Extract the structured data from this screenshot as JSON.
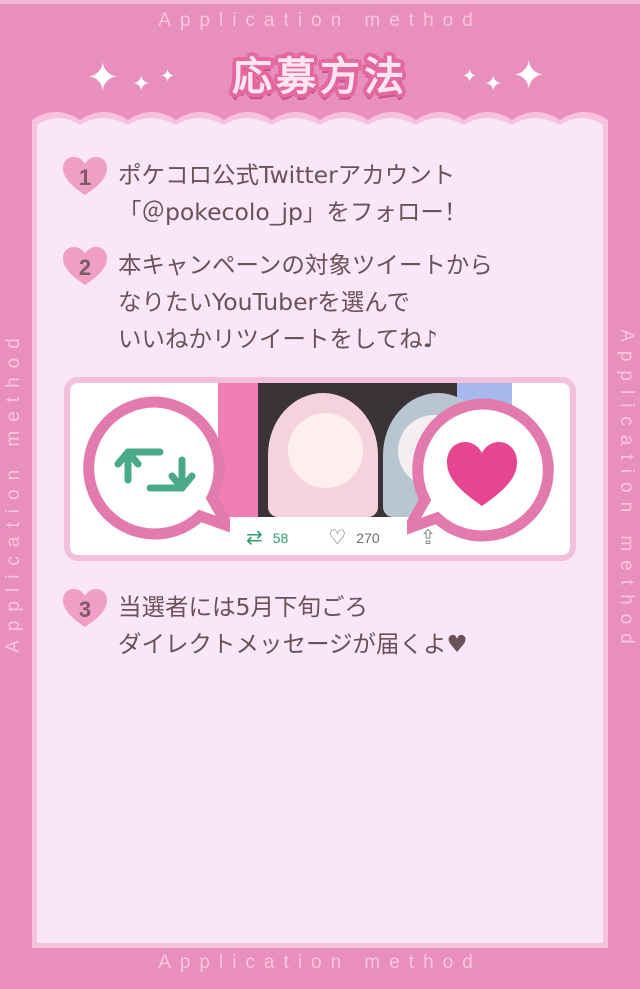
{
  "border_text": {
    "top": "Application method",
    "bottom": "Application method",
    "left": "Application method",
    "right": "Application method"
  },
  "title": "応募方法",
  "steps": [
    {
      "number": "1",
      "lines": [
        "ポケコロ公式Twitterアカウント",
        "「＠pokecolo_jp」をフォロー！"
      ]
    },
    {
      "number": "2",
      "lines": [
        "本キャンペーンの対象ツイートから",
        "なりたいYouTuberを選んで",
        "いいねかリツイートをしてね♪"
      ]
    },
    {
      "number": "3",
      "lines": [
        "当選者には5月下旬ごろ",
        "ダイレクトメッセージが届くよ♥"
      ]
    }
  ],
  "tweet": {
    "retweet_count": "58",
    "like_count": "270",
    "icons": {
      "retweet": "retweet-icon",
      "like": "heart-outline-icon",
      "share": "share-icon"
    }
  },
  "colors": {
    "border_pink": "#e98fbd",
    "panel_bg": "#f9e6f9",
    "title_outline": "#e4679f",
    "retweet_green": "#4aa88b",
    "heart_pink": "#e5468f"
  }
}
